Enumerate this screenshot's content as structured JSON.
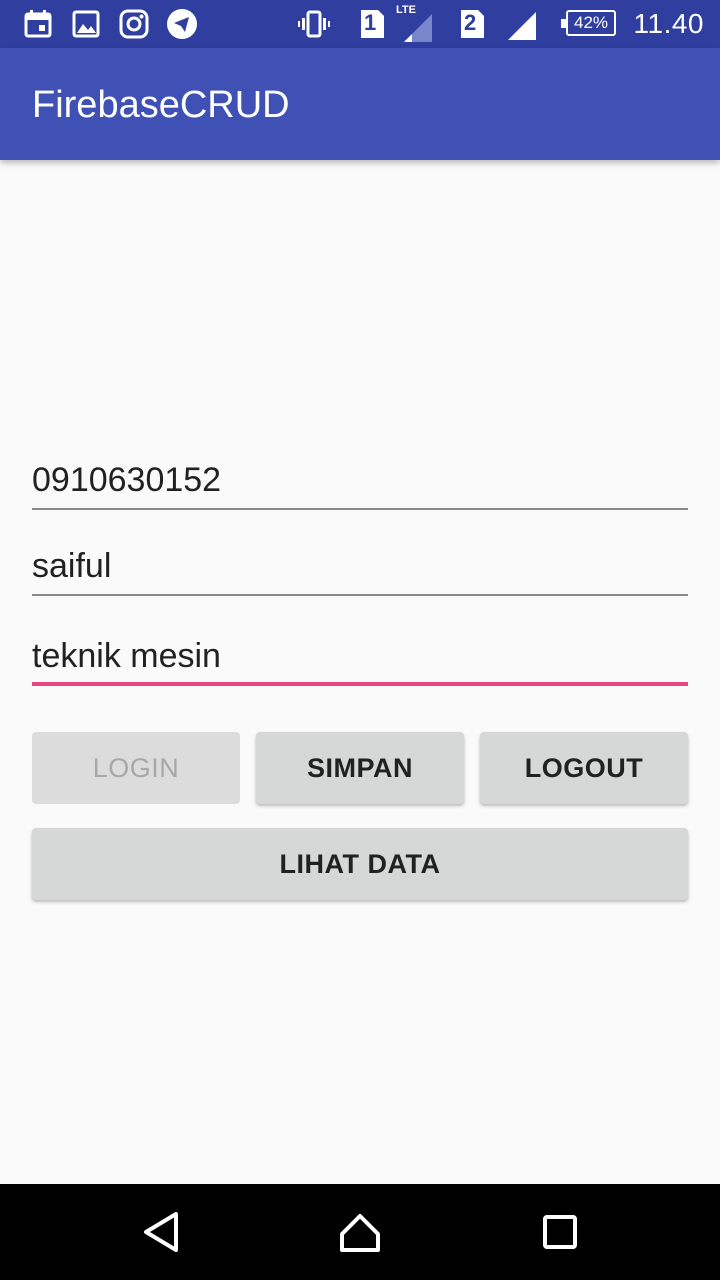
{
  "status_bar": {
    "time": "11.40",
    "battery": "42%",
    "network_label": "LTE",
    "sim1_label": "1",
    "sim2_label": "2",
    "icons": [
      "calendar-icon",
      "image-icon",
      "instagram-icon",
      "telegram-icon",
      "vibrate-icon",
      "sim1-icon",
      "signal1-icon",
      "sim2-icon",
      "signal2-icon",
      "battery-icon"
    ]
  },
  "app_bar": {
    "title": "FirebaseCRUD",
    "color": "#3f51b5"
  },
  "form": {
    "nim_value": "0910630152",
    "nama_value": "saiful",
    "jurusan_value": "teknik mesin",
    "accent_color": "#e8477e"
  },
  "buttons": {
    "login_label": "LOGIN",
    "simpan_label": "SIMPAN",
    "logout_label": "LOGOUT",
    "lihat_data_label": "LIHAT DATA"
  },
  "nav_bar": {
    "icons": [
      "back-icon",
      "home-icon",
      "recents-icon"
    ]
  }
}
